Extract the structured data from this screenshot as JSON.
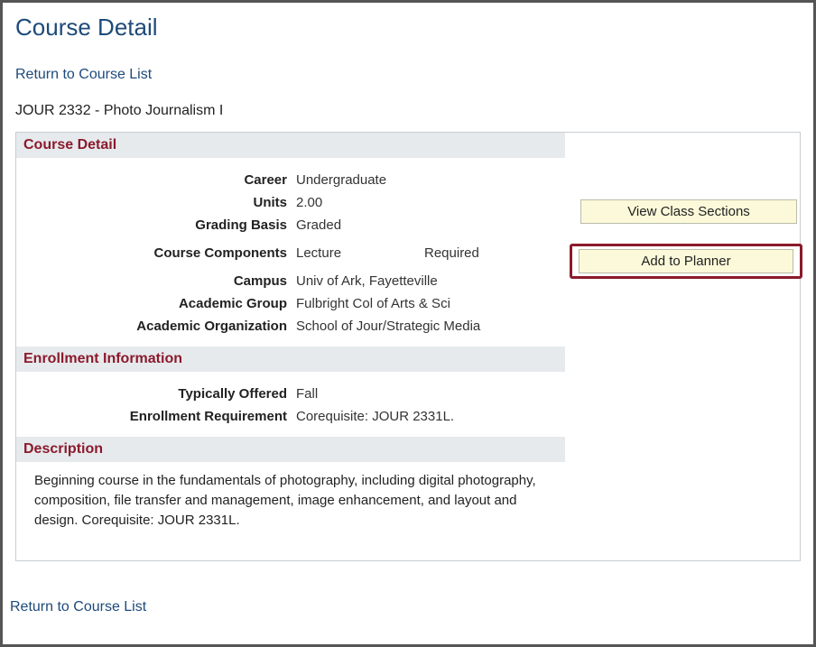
{
  "page_title": "Course Detail",
  "return_link": "Return to Course List",
  "course_code": "JOUR 2332 - Photo Journalism I",
  "sections": {
    "course_detail_header": "Course Detail",
    "enrollment_header": "Enrollment Information",
    "description_header": "Description"
  },
  "details": {
    "career_label": "Career",
    "career_value": "Undergraduate",
    "units_label": "Units",
    "units_value": "2.00",
    "grading_label": "Grading Basis",
    "grading_value": "Graded",
    "components_label": "Course Components",
    "components_type": "Lecture",
    "components_req": "Required",
    "campus_label": "Campus",
    "campus_value": "Univ of Ark, Fayetteville",
    "group_label": "Academic Group",
    "group_value": "Fulbright Col of Arts & Sci",
    "org_label": "Academic Organization",
    "org_value": "School of Jour/Strategic Media"
  },
  "enrollment": {
    "offered_label": "Typically Offered",
    "offered_value": "Fall",
    "req_label": "Enrollment Requirement",
    "req_value": "Corequisite:  JOUR 2331L."
  },
  "description_text": "Beginning course in the fundamentals of photography, including digital photography, composition, file transfer and management, image enhancement, and layout and design.  Corequisite:  JOUR 2331L.",
  "buttons": {
    "view_sections": "View Class Sections",
    "add_planner": "Add to Planner"
  }
}
